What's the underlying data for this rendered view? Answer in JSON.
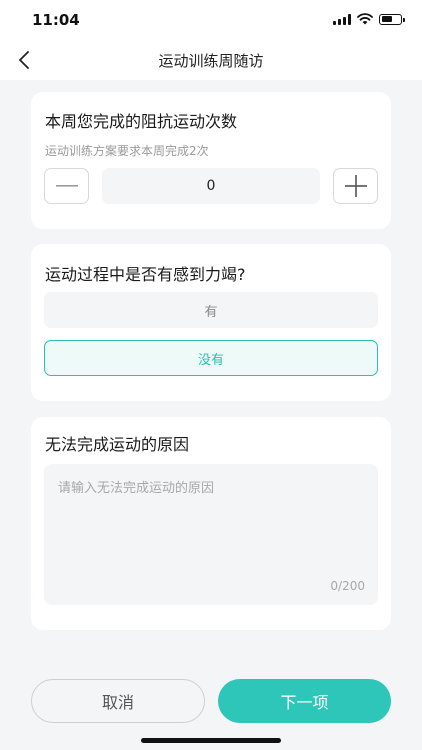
{
  "status_bar": {
    "time": "11:04"
  },
  "nav": {
    "title": "运动训练周随访"
  },
  "resistance_card": {
    "title": "本周您完成的阻抗运动次数",
    "subtitle": "运动训练方案要求本周完成2次",
    "count_value": "0"
  },
  "fatigue_card": {
    "title": "运动过程中是否有感到力竭?",
    "options": [
      {
        "label": "有",
        "selected": false
      },
      {
        "label": "没有",
        "selected": true
      }
    ]
  },
  "reason_card": {
    "title": "无法完成运动的原因",
    "placeholder": "请输入无法完成运动的原因",
    "value": "",
    "char_count": "0/200"
  },
  "footer": {
    "cancel_label": "取消",
    "next_label": "下一项"
  },
  "colors": {
    "accent": "#2ec6b8",
    "selected_text": "#2bbfb0",
    "background": "#f4f5f7"
  }
}
